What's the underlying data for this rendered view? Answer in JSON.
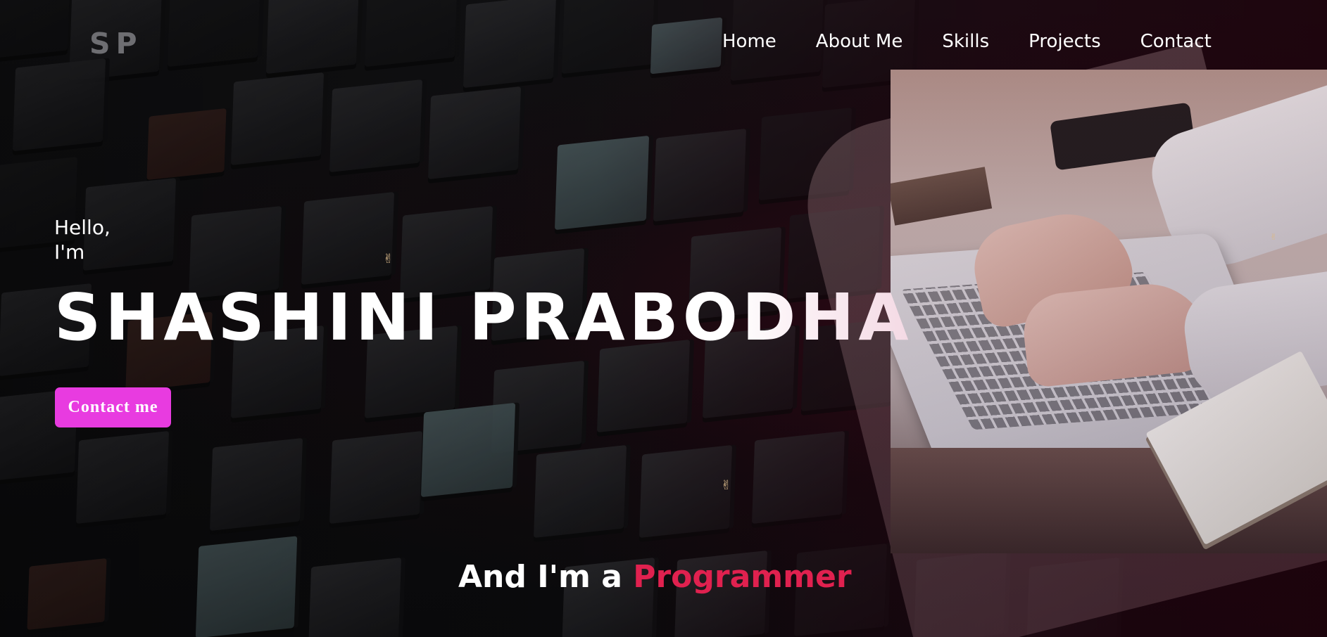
{
  "logo": {
    "text": "SP"
  },
  "nav": {
    "items": [
      {
        "label": "Home"
      },
      {
        "label": "About Me"
      },
      {
        "label": "Skills"
      },
      {
        "label": "Projects"
      },
      {
        "label": "Contact"
      }
    ]
  },
  "hero": {
    "greeting_line1": "Hello,",
    "greeting_line2": "I'm",
    "name": "SHASHINI PRABODHA",
    "contact_button": "Contact me",
    "tagline_prefix": "And I'm a ",
    "tagline_role": "Programmer"
  },
  "colors": {
    "accent_button": "#e83be0",
    "role_text": "#e0214f",
    "logo_text": "#6e6e72",
    "background": "#0d0d0f"
  },
  "icons": {
    "sparkle": "hand-sparkle-icon"
  }
}
